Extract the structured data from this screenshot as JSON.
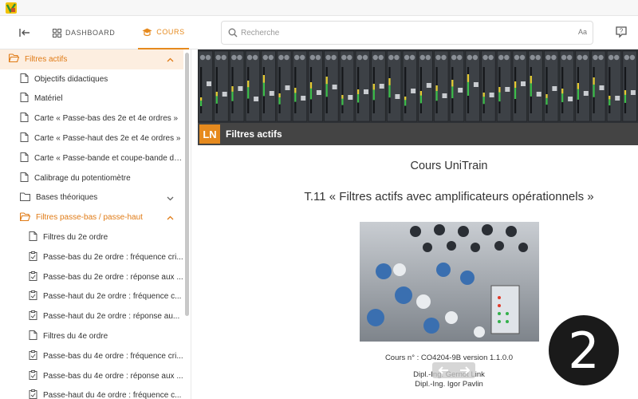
{
  "header": {
    "tabs": [
      {
        "label": "DASHBOARD",
        "icon": "dashboard-grid-icon"
      },
      {
        "label": "COURS",
        "icon": "graduation-cap-icon",
        "active": true
      }
    ],
    "search": {
      "placeholder": "Recherche",
      "case_toggle": "Aa"
    }
  },
  "sidebar": {
    "items": [
      {
        "label": "Filtres actifs",
        "level": 0,
        "type": "folder-open",
        "expanded": true,
        "active": true
      },
      {
        "label": "Objectifs didactiques",
        "level": 1,
        "type": "page"
      },
      {
        "label": "Matériel",
        "level": 1,
        "type": "page"
      },
      {
        "label": "Carte « Passe-bas des 2e et 4e ordres »",
        "level": 1,
        "type": "page"
      },
      {
        "label": "Carte « Passe-haut des 2e et 4e ordres »",
        "level": 1,
        "type": "page"
      },
      {
        "label": "Carte « Passe-bande et coupe-bande du...",
        "level": 1,
        "type": "page"
      },
      {
        "label": "Calibrage du potentiomètre",
        "level": 1,
        "type": "page"
      },
      {
        "label": "Bases théoriques",
        "level": 1,
        "type": "folder",
        "expanded": false
      },
      {
        "label": "Filtres passe-bas / passe-haut",
        "level": 1,
        "type": "folder-open",
        "expanded": true,
        "highlight": true
      },
      {
        "label": "Filtres du 2e ordre",
        "level": 2,
        "type": "page"
      },
      {
        "label": "Passe-bas du 2e ordre : fréquence cri...",
        "level": 2,
        "type": "task"
      },
      {
        "label": "Passe-bas du 2e ordre : réponse aux ...",
        "level": 2,
        "type": "task"
      },
      {
        "label": "Passe-haut du 2e ordre : fréquence c...",
        "level": 2,
        "type": "task"
      },
      {
        "label": "Passe-haut du 2e ordre : réponse au...",
        "level": 2,
        "type": "task"
      },
      {
        "label": "Filtres du 4e ordre",
        "level": 2,
        "type": "page"
      },
      {
        "label": "Passe-bas du 4e ordre : fréquence cri...",
        "level": 2,
        "type": "task"
      },
      {
        "label": "Passe-bas du 4e ordre : réponse aux ...",
        "level": 2,
        "type": "task"
      },
      {
        "label": "Passe-haut du 4e ordre : fréquence c...",
        "level": 2,
        "type": "task"
      }
    ]
  },
  "content": {
    "chapter_title": "Filtres actifs",
    "logo_text": "LN",
    "course_heading": "Cours UniTrain",
    "course_title": "T.11 « Filtres actifs avec amplificateurs opérationnels »",
    "course_number": "Cours n° : CO4204-9B version 1.1.0.0",
    "author_1": "Dipl.-Ing. Gernot Link",
    "author_2": "Dipl.-Ing. Igor Pavlin",
    "page_badge": "2"
  },
  "colors": {
    "accent": "#e68a1e",
    "accent_bg": "#fdeee0",
    "chapter_bar": "#444444",
    "badge": "#1a1a1a"
  }
}
